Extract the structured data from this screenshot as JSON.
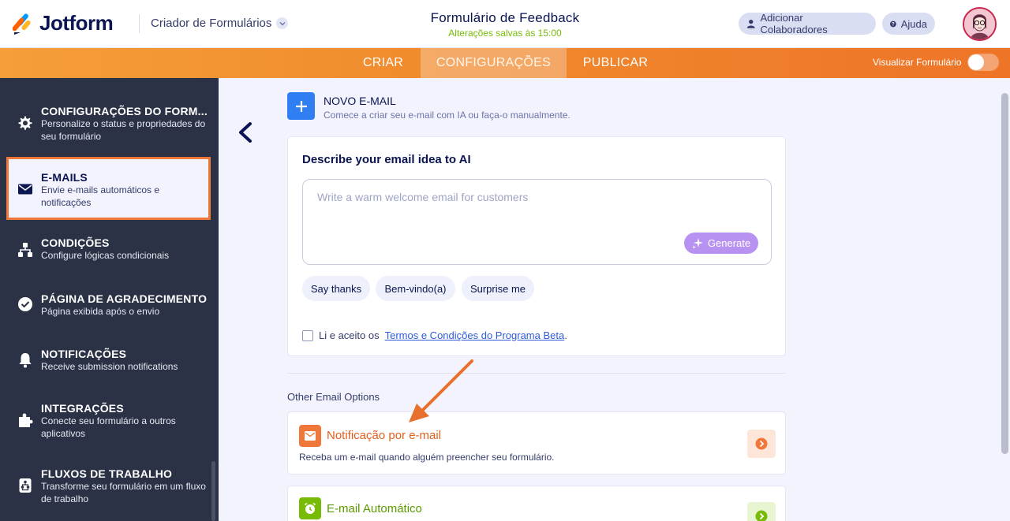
{
  "header": {
    "logo_text": "Jotform",
    "builder_label": "Criador de Formulários",
    "form_title": "Formulário de Feedback",
    "saved_status": "Alterações salvas às 15:00",
    "add_collaborators_label": "Adicionar Colaboradores",
    "help_label": "Ajuda"
  },
  "nav": {
    "tabs": [
      {
        "label": "CRIAR"
      },
      {
        "label": "CONFIGURAÇÕES"
      },
      {
        "label": "PUBLICAR"
      }
    ],
    "active_tab": "CONFIGURAÇÕES",
    "preview_label": "Visualizar Formulário",
    "preview_enabled": false
  },
  "sidebar": {
    "items": [
      {
        "title": "CONFIGURAÇÕES DO FORM...",
        "desc": "Personalize o status e propriedades do seu formulário",
        "icon": "gear-icon"
      },
      {
        "title": "E-MAILS",
        "desc": "Envie e-mails automáticos e notificações",
        "icon": "envelope-icon"
      },
      {
        "title": "CONDIÇÕES",
        "desc": "Configure lógicas condicionais",
        "icon": "sitemap-icon"
      },
      {
        "title": "PÁGINA DE AGRADECIMENTO",
        "desc": "Página exibida após o envio",
        "icon": "check-circle-icon"
      },
      {
        "title": "NOTIFICAÇÕES",
        "desc": "Receive submission notifications",
        "icon": "bell-icon"
      },
      {
        "title": "INTEGRAÇÕES",
        "desc": "Conecte seu formulário a outros aplicativos",
        "icon": "puzzle-icon"
      },
      {
        "title": "FLUXOS DE TRABALHO",
        "desc": "Transforme seu formulário em um fluxo de trabalho",
        "icon": "workflow-icon"
      }
    ],
    "selected": "E-MAILS"
  },
  "main": {
    "new_email": {
      "title": "NOVO E-MAIL",
      "subtitle": "Comece a criar seu e-mail com IA ou faça-o manualmente."
    },
    "ai": {
      "title": "Describe your email idea to AI",
      "placeholder": "Write a warm welcome email for customers",
      "generate_label": "Generate",
      "chips": [
        "Say thanks",
        "Bem-vindo(a)",
        "Surprise me"
      ],
      "terms_prefix": "Li e aceito os",
      "terms_link": "Termos e Condições do Programa Beta",
      "terms_suffix": "."
    },
    "other_label": "Other Email Options",
    "options": [
      {
        "title": "Notificação por e-mail",
        "desc": "Receba um e-mail quando alguém preencher seu formulário.",
        "color": "#f0773a"
      },
      {
        "title": "E-mail Automático",
        "desc": "",
        "color": "#78bb07"
      }
    ]
  },
  "colors": {
    "accent_orange": "#f0773a",
    "accent_green": "#78bb07",
    "sidebar_bg": "#2b3245",
    "primary_blue": "#2f7ff2",
    "ai_purple": "#b892f0"
  }
}
